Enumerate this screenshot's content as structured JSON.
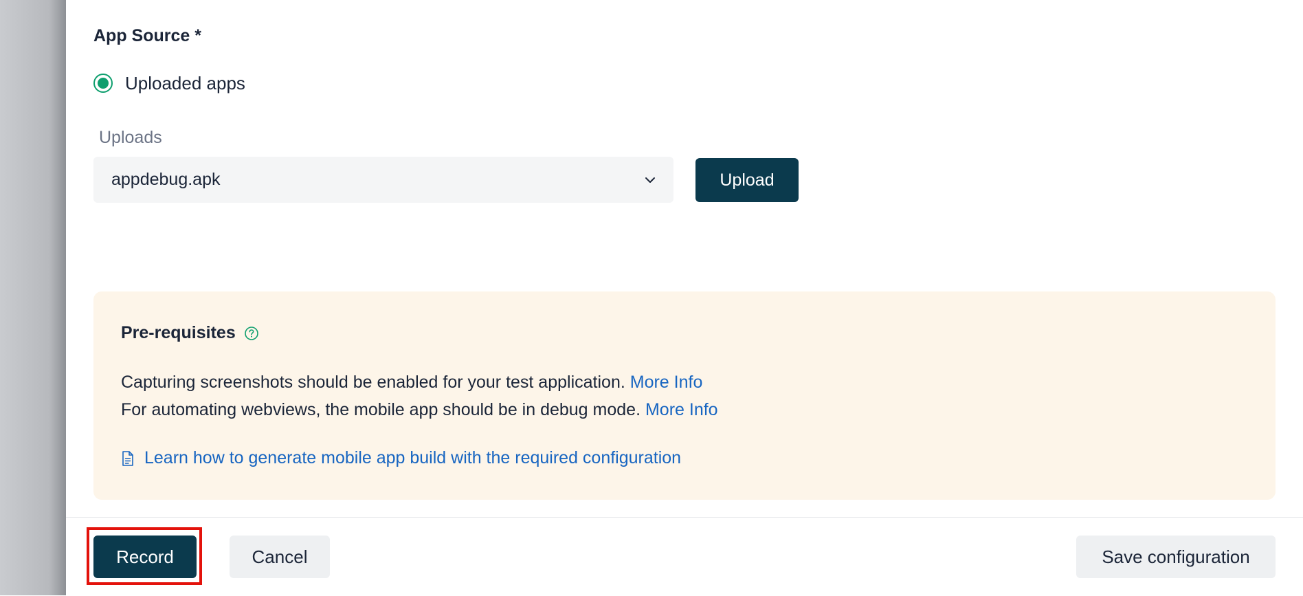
{
  "app_source": {
    "title": "App Source *",
    "radio_option": "Uploaded apps",
    "radio_selected": true
  },
  "uploads": {
    "label": "Uploads",
    "selected_value": "appdebug.apk",
    "upload_button": "Upload"
  },
  "prerequisites": {
    "title": "Pre-requisites",
    "line1_text": "Capturing screenshots should be enabled for your test application.",
    "line1_link": "More Info",
    "line2_text": "For automating webviews, the mobile app should be in debug mode.",
    "line2_link": "More Info",
    "learn_link": "Learn how to generate mobile app build with the required configuration"
  },
  "footer": {
    "record_button": "Record",
    "cancel_button": "Cancel",
    "save_button": "Save configuration"
  },
  "colors": {
    "primary": "#0b3a4d",
    "radio_accent": "#0e9f6e",
    "link": "#1765c1",
    "notice_bg": "#fdf5e9",
    "highlight": "#e3120b"
  },
  "icons": {
    "help": "question-circle-icon",
    "doc": "document-icon",
    "dropdown": "chevron-down-icon"
  }
}
